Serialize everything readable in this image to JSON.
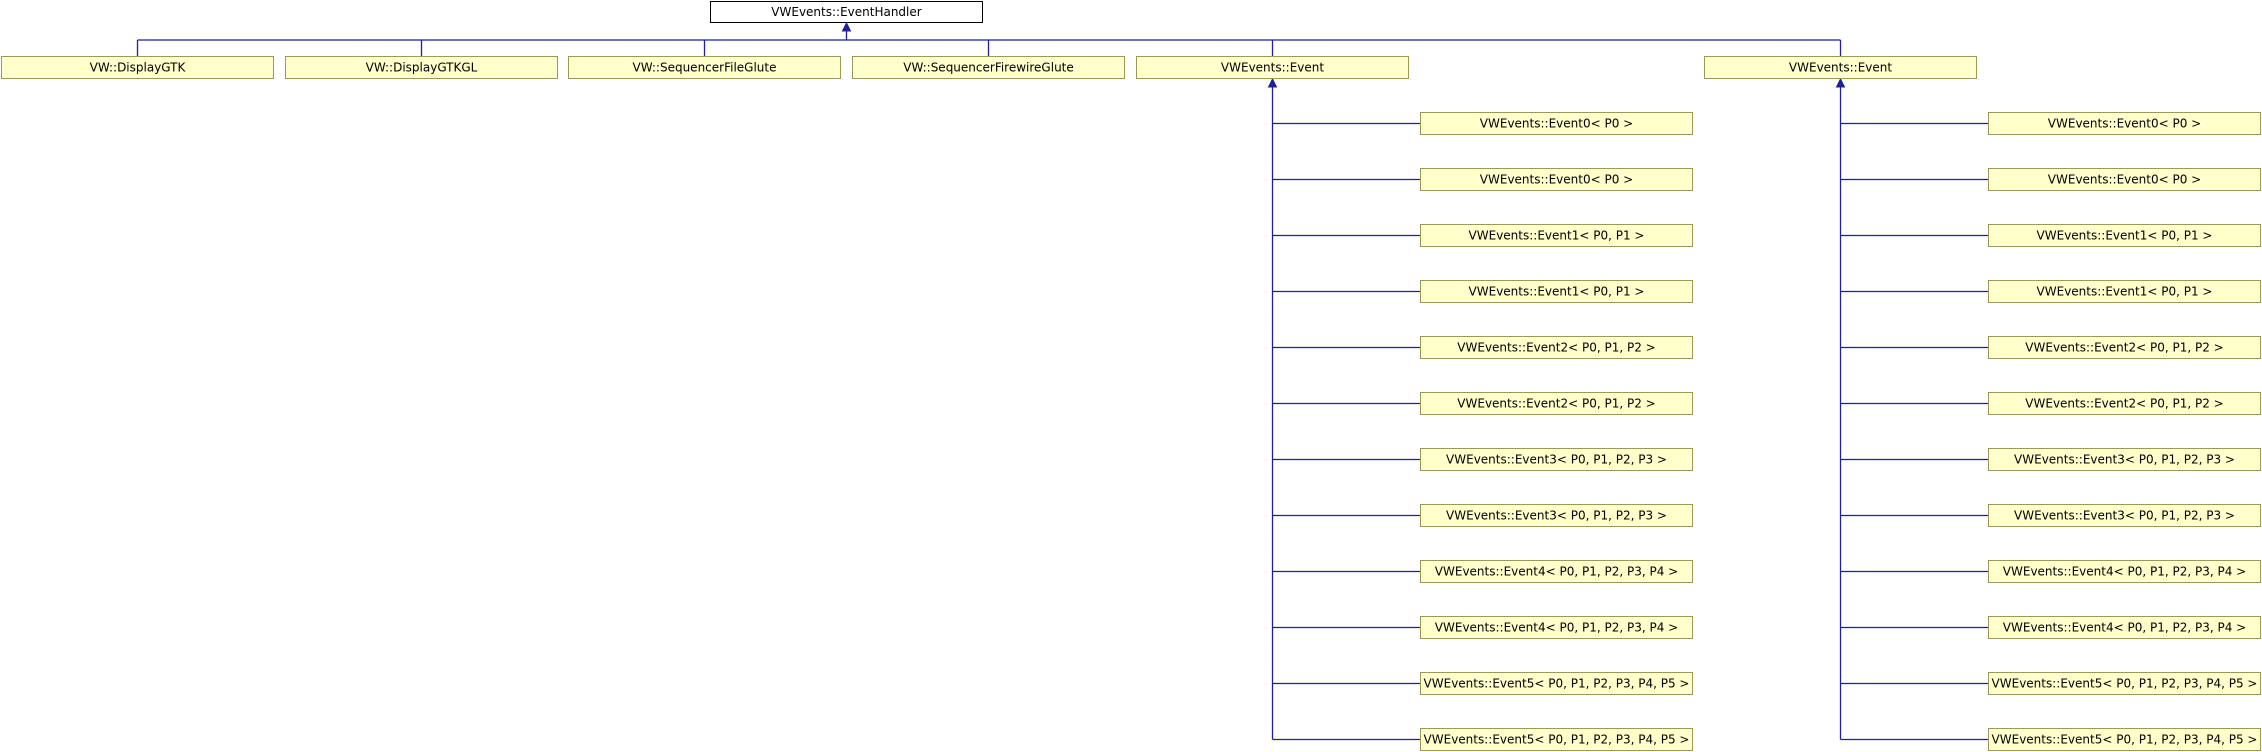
{
  "diagram": {
    "root": "VWEvents::EventHandler",
    "children": [
      {
        "label": "VW::DisplayGTK"
      },
      {
        "label": "VW::DisplayGTKGL"
      },
      {
        "label": "VW::SequencerFileGlute"
      },
      {
        "label": "VW::SequencerFirewireGlute"
      },
      {
        "label": "VWEvents::Event",
        "children": [
          "VWEvents::Event0< P0 >",
          "VWEvents::Event0< P0 >",
          "VWEvents::Event1< P0, P1 >",
          "VWEvents::Event1< P0, P1 >",
          "VWEvents::Event2< P0, P1, P2 >",
          "VWEvents::Event2< P0, P1, P2 >",
          "VWEvents::Event3< P0, P1, P2, P3 >",
          "VWEvents::Event3< P0, P1, P2, P3 >",
          "VWEvents::Event4< P0, P1, P2, P3, P4 >",
          "VWEvents::Event4< P0, P1, P2, P3, P4 >",
          "VWEvents::Event5< P0, P1, P2, P3, P4, P5 >",
          "VWEvents::Event5< P0, P1, P2, P3, P4, P5 >"
        ]
      },
      {
        "label": "VWEvents::Event",
        "children": [
          "VWEvents::Event0< P0 >",
          "VWEvents::Event0< P0 >",
          "VWEvents::Event1< P0, P1 >",
          "VWEvents::Event1< P0, P1 >",
          "VWEvents::Event2< P0, P1, P2 >",
          "VWEvents::Event2< P0, P1, P2 >",
          "VWEvents::Event3< P0, P1, P2, P3 >",
          "VWEvents::Event3< P0, P1, P2, P3 >",
          "VWEvents::Event4< P0, P1, P2, P3, P4 >",
          "VWEvents::Event4< P0, P1, P2, P3, P4 >",
          "VWEvents::Event5< P0, P1, P2, P3, P4, P5 >",
          "VWEvents::Event5< P0, P1, P2, P3, P4, P5 >"
        ]
      }
    ]
  },
  "colors": {
    "node_fill": "#ffffcc",
    "node_border": "#9a9a56",
    "root_fill": "#ffffff",
    "root_border": "#000000",
    "edge": "#1f1fa0"
  }
}
